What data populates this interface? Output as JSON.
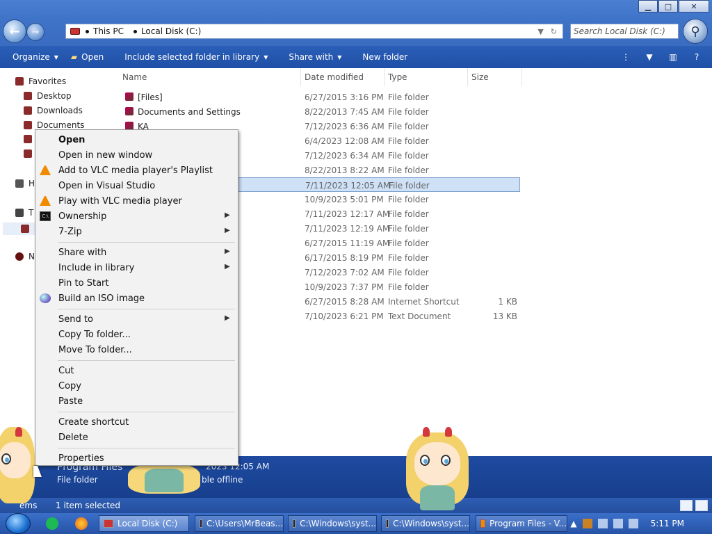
{
  "window": {
    "minimize_glyph": "▁",
    "maximize_glyph": "□",
    "close_glyph": "✕"
  },
  "address": {
    "segments": [
      "This PC",
      "Local Disk (C:)"
    ],
    "search_placeholder": "Search Local Disk (C:)"
  },
  "toolbar": {
    "organize": "Organize",
    "open": "Open",
    "include": "Include selected folder in library",
    "share": "Share with",
    "new_folder": "New folder"
  },
  "nav": {
    "favorites": "Favorites",
    "desktop": "Desktop",
    "downloads": "Downloads",
    "documents": "Documents",
    "homegroup_partial": "H",
    "thispc_partial": "T",
    "network_partial": "N"
  },
  "columns": {
    "name": "Name",
    "date": "Date modified",
    "type": "Type",
    "size": "Size"
  },
  "files": [
    {
      "name": "[Files]",
      "date": "6/27/2015 3:16 PM",
      "type": "File folder",
      "size": ""
    },
    {
      "name": "Documents and Settings",
      "date": "8/22/2013 7:45 AM",
      "type": "File folder",
      "size": ""
    },
    {
      "name": "KA",
      "date": "7/12/2023 6:36 AM",
      "type": "File folder",
      "size": ""
    },
    {
      "name": "",
      "date": "6/4/2023 12:08 AM",
      "type": "File folder",
      "size": ""
    },
    {
      "name": "",
      "date": "7/12/2023 6:34 AM",
      "type": "File folder",
      "size": ""
    },
    {
      "name": "",
      "date": "8/22/2013 8:22 AM",
      "type": "File folder",
      "size": ""
    },
    {
      "name": "",
      "date": "7/11/2023 12:05 AM",
      "type": "File folder",
      "size": ""
    },
    {
      "name": "",
      "date": "10/9/2023 5:01 PM",
      "type": "File folder",
      "size": ""
    },
    {
      "name": "",
      "date": "7/11/2023 12:17 AM",
      "type": "File folder",
      "size": ""
    },
    {
      "name": "",
      "date": "7/11/2023 12:19 AM",
      "type": "File folder",
      "size": ""
    },
    {
      "name": "",
      "date": "6/27/2015 11:19 AM",
      "type": "File folder",
      "size": ""
    },
    {
      "name": "",
      "date": "6/17/2015 8:19 PM",
      "type": "File folder",
      "size": ""
    },
    {
      "name": "",
      "date": "7/12/2023 7:02 AM",
      "type": "File folder",
      "size": ""
    },
    {
      "name": "",
      "date": "10/9/2023 7:37 PM",
      "type": "File folder",
      "size": ""
    },
    {
      "name": "",
      "date": "6/27/2015 8:28 AM",
      "type": "Internet Shortcut",
      "size": "1 KB"
    },
    {
      "name": "",
      "date": "7/10/2023 6:21 PM",
      "type": "Text Document",
      "size": "13 KB"
    }
  ],
  "context_menu": [
    {
      "label": "Open",
      "bold": true,
      "icon": "",
      "submenu": false
    },
    {
      "label": "Open in new window",
      "icon": "",
      "submenu": false
    },
    {
      "label": "Add to VLC media player's Playlist",
      "icon": "vlc-icon",
      "submenu": false
    },
    {
      "label": "Open in Visual Studio",
      "icon": "",
      "submenu": false
    },
    {
      "label": "Play with VLC media player",
      "icon": "vlc-icon",
      "submenu": false
    },
    {
      "label": "Ownership",
      "icon": "cmd-icon",
      "submenu": true
    },
    {
      "label": "7-Zip",
      "icon": "",
      "submenu": true
    },
    {
      "sep": true
    },
    {
      "label": "Share with",
      "icon": "",
      "submenu": true
    },
    {
      "label": "Include in library",
      "icon": "",
      "submenu": true
    },
    {
      "label": "Pin to Start",
      "icon": "",
      "submenu": false
    },
    {
      "label": "Build an ISO image",
      "icon": "iso-icon",
      "submenu": false
    },
    {
      "sep": true
    },
    {
      "label": "Send to",
      "icon": "",
      "submenu": true
    },
    {
      "label": "Copy To folder...",
      "icon": "",
      "submenu": false
    },
    {
      "label": "Move To folder...",
      "icon": "",
      "submenu": false
    },
    {
      "sep": true
    },
    {
      "label": "Cut",
      "icon": "",
      "submenu": false
    },
    {
      "label": "Copy",
      "icon": "",
      "submenu": false
    },
    {
      "label": "Paste",
      "icon": "",
      "submenu": false
    },
    {
      "sep": true
    },
    {
      "label": "Create shortcut",
      "icon": "",
      "submenu": false
    },
    {
      "label": "Delete",
      "icon": "",
      "submenu": false
    },
    {
      "sep": true
    },
    {
      "label": "Properties",
      "icon": "",
      "submenu": false
    }
  ],
  "details": {
    "name": "Program Files",
    "type": "File folder",
    "modified_partial": "2023 12:05 AM",
    "offline_partial": "ble offline"
  },
  "status": {
    "items_partial": "ems",
    "selected": "1 item selected"
  },
  "taskbar": {
    "tasks": [
      {
        "label": "Local Disk (C:)",
        "active": true
      },
      {
        "label": "C:\\Users\\MrBeas...",
        "active": false
      },
      {
        "label": "C:\\Windows\\syst...",
        "active": false
      },
      {
        "label": "C:\\Windows\\syst...",
        "active": false
      },
      {
        "label": "Program Files - V...",
        "active": false
      }
    ],
    "clock": "5:11 PM"
  },
  "colors": {
    "accent": "#2b5fb8",
    "selection": "#cfe1f7",
    "vlc": "#f08a00"
  }
}
